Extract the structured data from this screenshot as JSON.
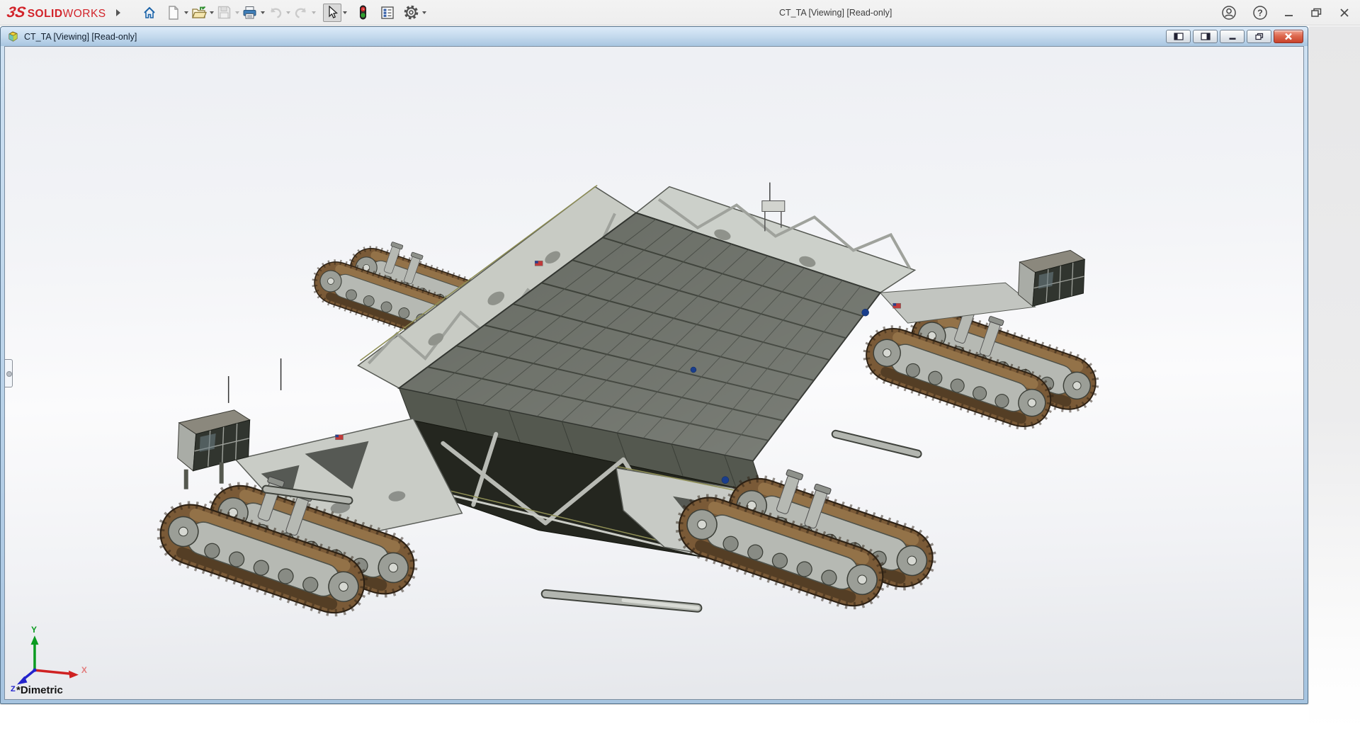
{
  "app": {
    "brand": {
      "glyph": "3S",
      "solid": "SOLID",
      "works": "WORKS"
    },
    "title": "CT_TA [Viewing] [Read-only]"
  },
  "toolbar": {
    "items": [
      {
        "name": "home"
      },
      {
        "name": "new-document"
      },
      {
        "name": "open"
      },
      {
        "name": "save",
        "state": "disabled"
      },
      {
        "name": "print"
      },
      {
        "name": "undo",
        "state": "disabled"
      },
      {
        "name": "redo",
        "state": "disabled"
      },
      {
        "name": "select",
        "state": "pressed"
      },
      {
        "name": "design-checker"
      },
      {
        "name": "properties"
      },
      {
        "name": "options"
      }
    ]
  },
  "window": {
    "title": "CT_TA [Viewing] [Read-only]",
    "controls": [
      "pane-left",
      "pane-right",
      "minimize",
      "restore",
      "close"
    ]
  },
  "viewport": {
    "orientation": "*Dimetric",
    "axes": {
      "x": "X",
      "y": "Y",
      "z": "Z"
    },
    "model": "NASA crawler-transporter assembly"
  },
  "colors": {
    "brand_red": "#d2232a",
    "titlebar_blue_top": "#dcebf9",
    "titlebar_blue_bottom": "#a8c6e1",
    "close_red": "#c8422a",
    "track_brown": "#7a5a37",
    "deck_gray": "#666a62",
    "truss_gray": "#c8cbc4",
    "axis_x": "#d83434",
    "axis_y": "#0a9b20",
    "axis_z": "#2323cc",
    "viewport_bg_top": "#edeff3",
    "viewport_bg_bottom": "#e4e6ea"
  }
}
